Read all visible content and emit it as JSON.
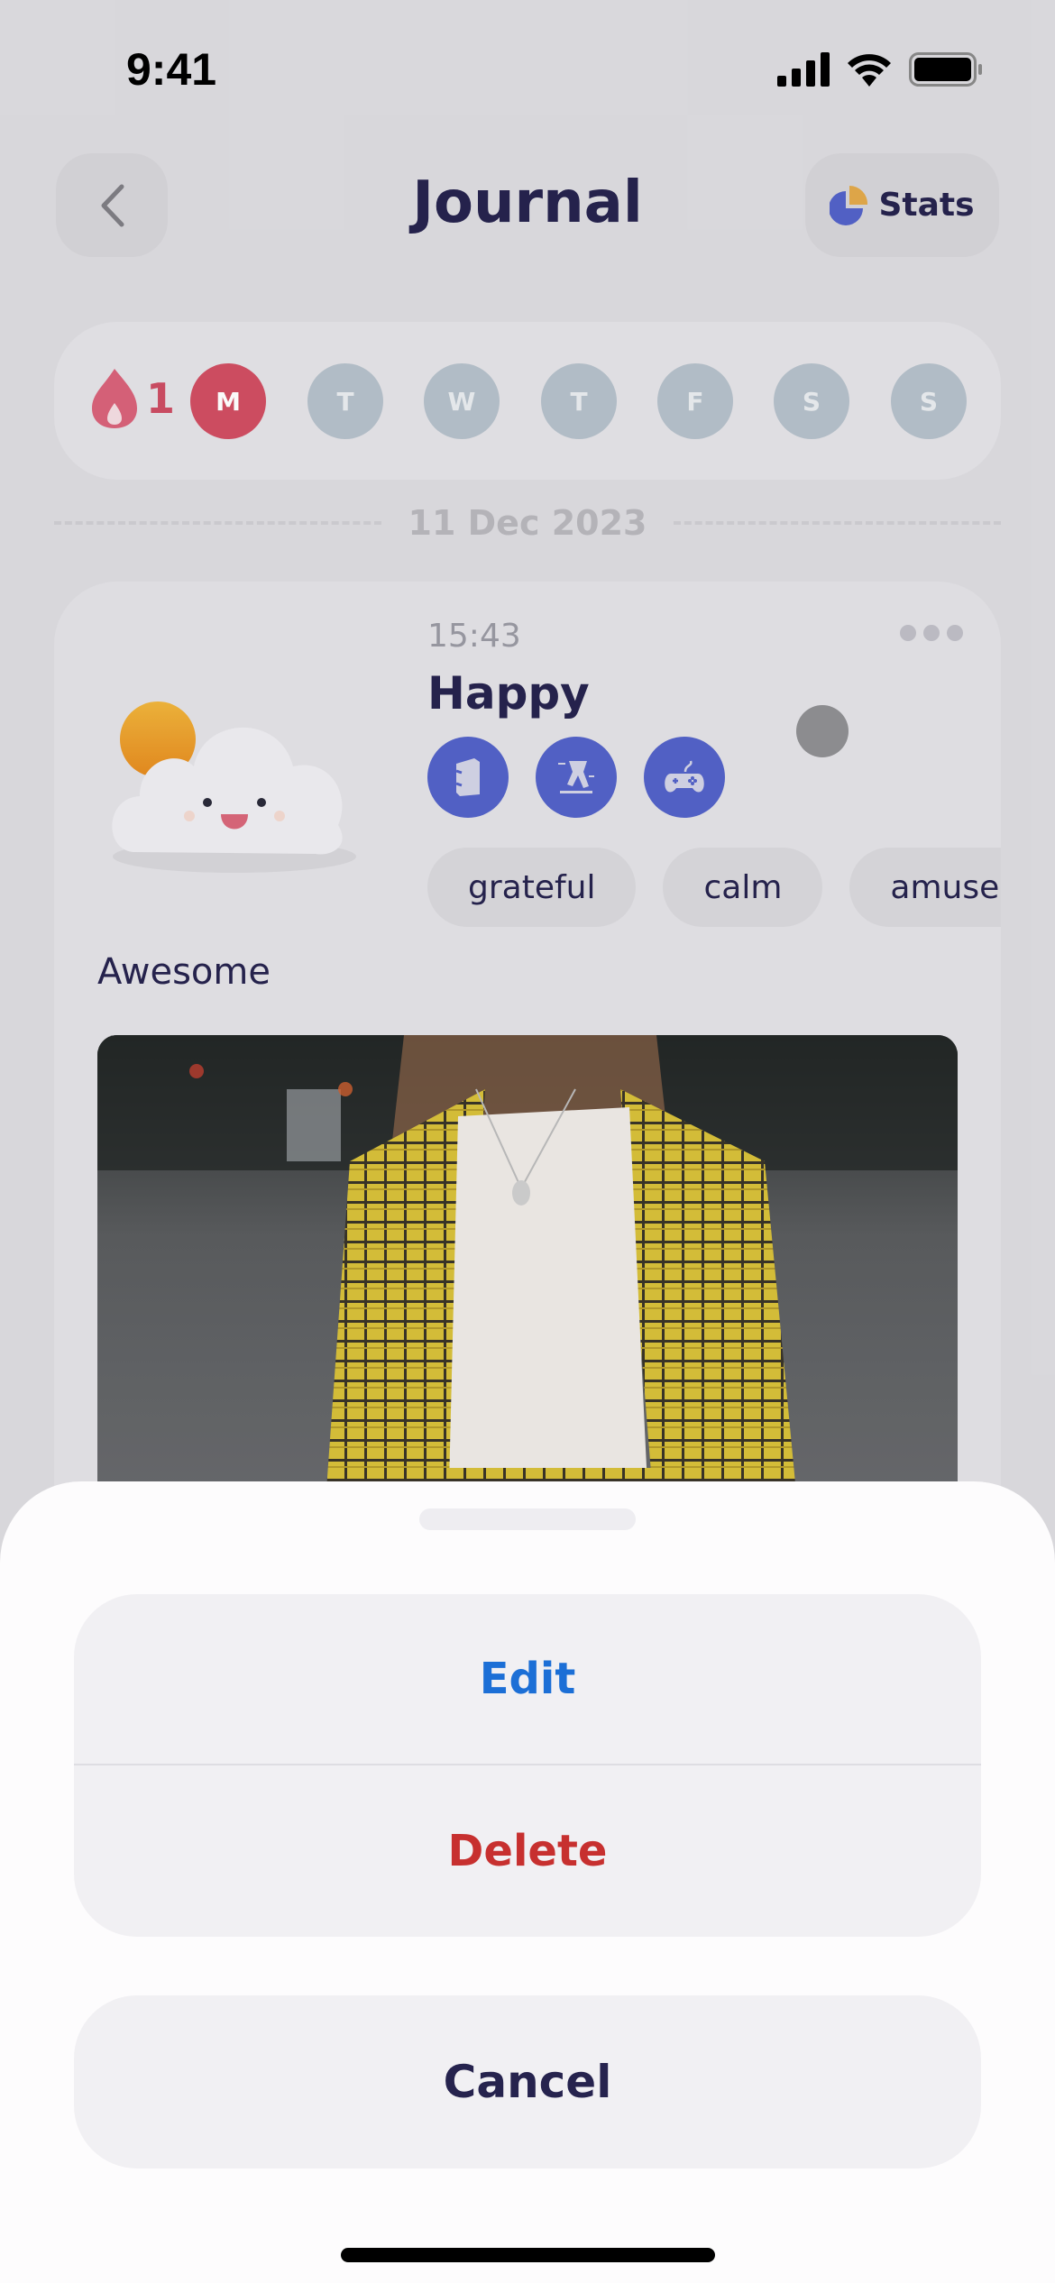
{
  "status_bar": {
    "time": "9:41"
  },
  "header": {
    "title": "Journal",
    "stats_label": "Stats"
  },
  "week": {
    "streak_count": "1",
    "days": [
      {
        "label": "M",
        "active": true
      },
      {
        "label": "T",
        "active": false
      },
      {
        "label": "W",
        "active": false
      },
      {
        "label": "T",
        "active": false
      },
      {
        "label": "F",
        "active": false
      },
      {
        "label": "S",
        "active": false
      },
      {
        "label": "S",
        "active": false
      }
    ]
  },
  "date_divider": "11 Dec 2023",
  "entry": {
    "time": "15:43",
    "mood": "Happy",
    "activities": [
      "book-icon",
      "running-icon",
      "gamepad-icon"
    ],
    "tags": [
      "grateful",
      "calm",
      "amused"
    ],
    "note": "Awesome"
  },
  "action_sheet": {
    "edit_label": "Edit",
    "delete_label": "Delete",
    "cancel_label": "Cancel"
  },
  "colors": {
    "accent": "#5362c8",
    "streak": "#d14e62",
    "edit": "#1c6fd6",
    "delete": "#c7302f",
    "title": "#26234e"
  }
}
